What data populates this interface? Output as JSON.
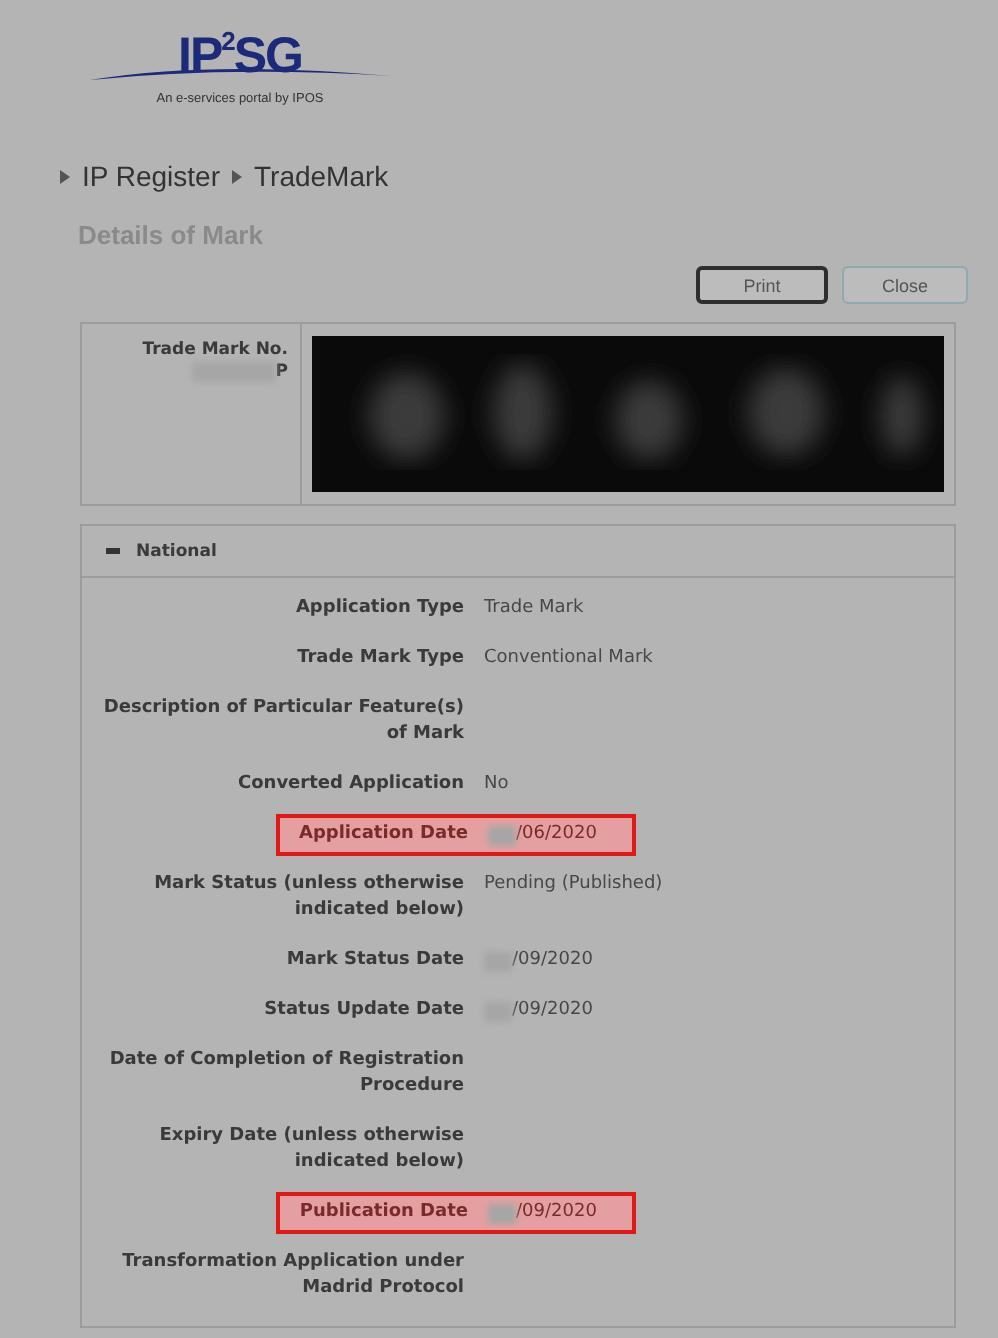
{
  "logo": {
    "wordmark": "IP$^{2}$SG",
    "tagline": "An e-services portal by IPOS"
  },
  "breadcrumb": [
    {
      "label": "IP Register"
    },
    {
      "label": "TradeMark"
    }
  ],
  "page_title": "Details of Mark",
  "buttons": [
    {
      "label": "Print",
      "focused": true
    },
    {
      "label": "Close",
      "focused": false
    }
  ],
  "mark": {
    "label": "Trade Mark No.",
    "number_suffix": "P"
  },
  "section": {
    "title": "National",
    "expanded": true,
    "rows": [
      {
        "label": "Application Type",
        "value": "Trade Mark",
        "highlighted": false
      },
      {
        "label": "Trade Mark Type",
        "value": "Conventional Mark",
        "highlighted": false
      },
      {
        "label": "Description of Particular Feature(s) of Mark",
        "value": "",
        "highlighted": false
      },
      {
        "label": "Converted Application",
        "value": "No",
        "highlighted": false
      },
      {
        "label": "Application Date",
        "value": "/06/2020",
        "redacted": true,
        "highlighted": true
      },
      {
        "label": "Mark Status (unless otherwise indicated below)",
        "value": "Pending (Published)",
        "highlighted": false
      },
      {
        "label": "Mark Status Date",
        "value": "/09/2020",
        "redacted": true,
        "highlighted": false
      },
      {
        "label": "Status Update Date",
        "value": "/09/2020",
        "redacted": true,
        "highlighted": false
      },
      {
        "label": "Date of Completion of Registration Procedure",
        "value": "",
        "highlighted": false
      },
      {
        "label": "Expiry Date (unless otherwise indicated below)",
        "value": "",
        "highlighted": false
      },
      {
        "label": "Publication Date",
        "value": "/09/2020",
        "redacted": true,
        "highlighted": true
      },
      {
        "label": "Transformation Application under Madrid Protocol",
        "value": "",
        "highlighted": false
      }
    ]
  }
}
